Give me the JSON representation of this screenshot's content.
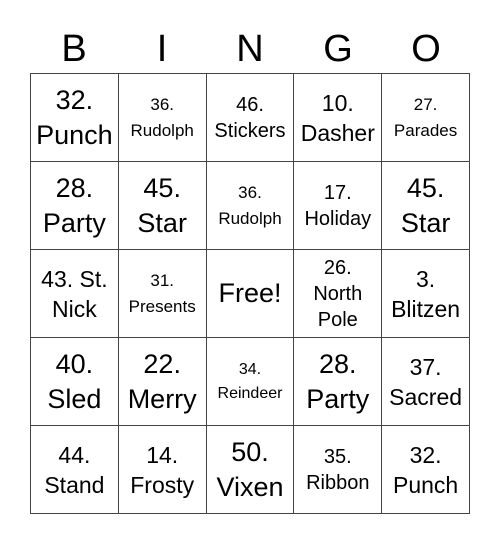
{
  "header": [
    "B",
    "I",
    "N",
    "G",
    "O"
  ],
  "cells": [
    {
      "text": "32. Punch",
      "size": "xl"
    },
    {
      "text": "36. Rudolph",
      "size": "s"
    },
    {
      "text": "46. Stickers",
      "size": "m"
    },
    {
      "text": "10. Dasher",
      "size": "l"
    },
    {
      "text": "27. Parades",
      "size": "s"
    },
    {
      "text": "28. Party",
      "size": "xl"
    },
    {
      "text": "45. Star",
      "size": "xl"
    },
    {
      "text": "36. Rudolph",
      "size": "s"
    },
    {
      "text": "17. Holiday",
      "size": "m"
    },
    {
      "text": "45. Star",
      "size": "xl"
    },
    {
      "text": "43. St. Nick",
      "size": "l"
    },
    {
      "text": "31. Presents",
      "size": "s"
    },
    {
      "text": "Free!",
      "size": "xl"
    },
    {
      "text": "26. North Pole",
      "size": "m"
    },
    {
      "text": "3. Blitzen",
      "size": "l"
    },
    {
      "text": "40. Sled",
      "size": "xl"
    },
    {
      "text": "22. Merry",
      "size": "xl"
    },
    {
      "text": "34. Reindeer",
      "size": "xs"
    },
    {
      "text": "28. Party",
      "size": "xl"
    },
    {
      "text": "37. Sacred",
      "size": "l"
    },
    {
      "text": "44. Stand",
      "size": "l"
    },
    {
      "text": "14. Frosty",
      "size": "l"
    },
    {
      "text": "50. Vixen",
      "size": "xl"
    },
    {
      "text": "35. Ribbon",
      "size": "m"
    },
    {
      "text": "32. Punch",
      "size": "l"
    }
  ]
}
